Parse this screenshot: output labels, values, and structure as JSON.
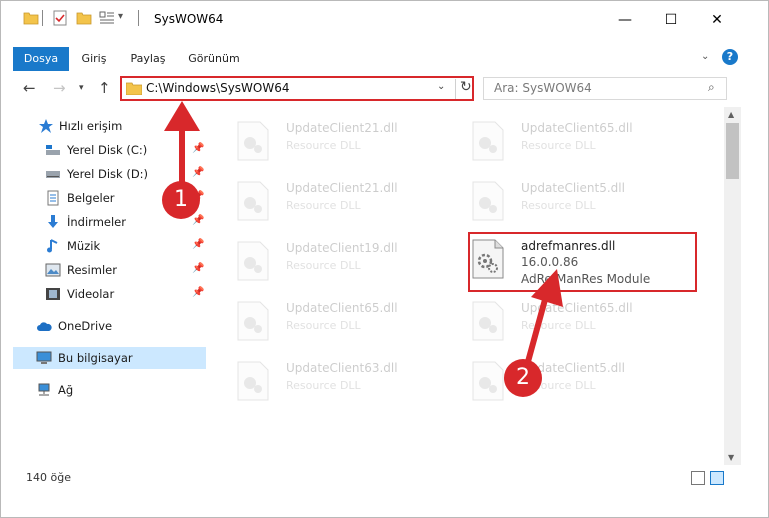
{
  "window": {
    "title": "SysWOW64",
    "minimize": "—",
    "maximize": "☐",
    "close": "✕"
  },
  "ribbon": {
    "tabs": [
      "Dosya",
      "Giriş",
      "Paylaş",
      "Görünüm"
    ],
    "help": "?"
  },
  "nav": {
    "address": "C:\\Windows\\SysWOW64",
    "search_placeholder": "Ara: SysWOW64"
  },
  "sidebar": {
    "quick_access": "Hızlı erişim",
    "items": [
      {
        "label": "Yerel Disk (C:)",
        "icon": "drive-icon"
      },
      {
        "label": "Yerel Disk (D:)",
        "icon": "drive-icon"
      },
      {
        "label": "Belgeler",
        "icon": "documents-icon"
      },
      {
        "label": "İndirmeler",
        "icon": "downloads-icon"
      },
      {
        "label": "Müzik",
        "icon": "music-icon"
      },
      {
        "label": "Resimler",
        "icon": "pictures-icon"
      },
      {
        "label": "Videolar",
        "icon": "videos-icon"
      }
    ],
    "onedrive": "OneDrive",
    "this_pc": "Bu bilgisayar",
    "network": "Ağ"
  },
  "files": [
    {
      "name": "UpdateClient21.dll",
      "desc": "Resource DLL"
    },
    {
      "name": "UpdateClient65.dll",
      "desc": "Resource DLL"
    },
    {
      "name": "UpdateClient21.dll",
      "desc": "Resource DLL"
    },
    {
      "name": "UpdateClient5.dll",
      "desc": "Resource DLL"
    },
    {
      "name": "UpdateClient19.dll",
      "desc": "Resource DLL"
    },
    {
      "name": "adrefmanres.dll",
      "version": "16.0.0.86",
      "desc": "AdRefManRes Module"
    },
    {
      "name": "UpdateClient65.dll",
      "desc": "Resource DLL"
    },
    {
      "name": "UpdateClient65.dll",
      "desc": "Resource DLL"
    },
    {
      "name": "UpdateClient63.dll",
      "desc": "Resource DLL"
    },
    {
      "name": "UpdateClient5.dll",
      "desc": "Resource DLL"
    }
  ],
  "annotations": {
    "step1": "1",
    "step2": "2"
  },
  "status": {
    "count": "140 öğe"
  },
  "colors": {
    "accent": "#1979ca",
    "highlight": "#d8282b",
    "selection": "#cce8ff"
  }
}
